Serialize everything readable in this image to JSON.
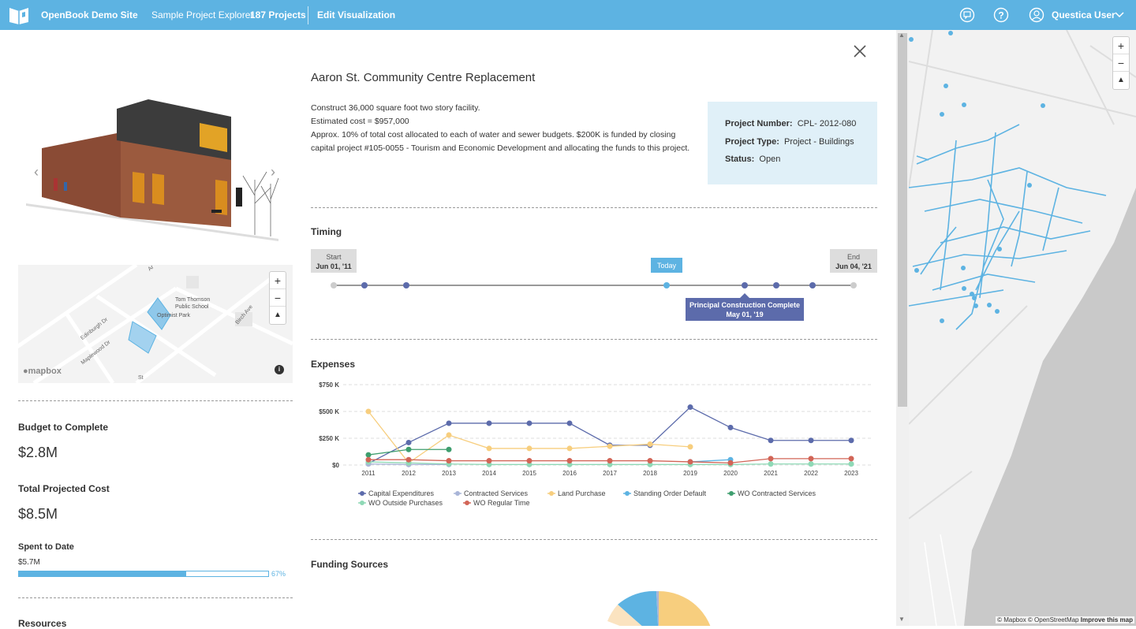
{
  "topbar": {
    "site_name": "OpenBook Demo Site",
    "explorer": "Sample Project Explorer",
    "project_count": "187 Projects",
    "edit_visualization": "Edit Visualization",
    "user_name": "Questica User",
    "bg_color": "#5db3e2"
  },
  "minimap": {
    "labels": [
      "Tom Thomson Public School",
      "Optimist Park",
      "Edinburgh Dr",
      "Maplewood Dr",
      "Birch Ave",
      "St",
      "Ar"
    ],
    "brand": "mapbox"
  },
  "metrics": {
    "budget_label": "Budget to Complete",
    "budget_value": "$2.8M",
    "total_label": "Total Projected Cost",
    "total_value": "$8.5M",
    "spent_label": "Spent to Date",
    "spent_value": "$5.7M",
    "spent_percent": 67,
    "spent_percent_text": "67%",
    "resources_label": "Resources"
  },
  "project": {
    "title": "Aaron St. Community Centre Replacement",
    "description": [
      "Construct 36,000 square foot two story facility.",
      "Estimated cost = $957,000",
      "Approx. 10% of total cost allocated to each of water and sewer budgets. $200K is funded by closing capital project #105-0055 - Tourism and Economic Development and allocating the funds to this project."
    ],
    "number_label": "Project Number:",
    "number_value": "CPL- 2012-080",
    "type_label": "Project Type:",
    "type_value": "Project - Buildings",
    "status_label": "Status:",
    "status_value": "Open"
  },
  "timing": {
    "title": "Timing",
    "start_label": "Start",
    "start_date": "Jun 01, '11",
    "end_label": "End",
    "end_date": "Jun 04, '21",
    "today_label": "Today",
    "milestone_name": "Principal Construction Complete",
    "milestone_date": "May 01, '19"
  },
  "expenses": {
    "title": "Expenses"
  },
  "funding": {
    "title": "Funding Sources"
  },
  "bigmap": {
    "attribution": "© Mapbox © OpenStreetMap",
    "improve": "Improve this map"
  },
  "chart_data": {
    "type": "line",
    "title": "Expenses",
    "x": [
      "2011",
      "2012",
      "2013",
      "2014",
      "2015",
      "2016",
      "2017",
      "2018",
      "2019",
      "2020",
      "2021",
      "2022",
      "2023"
    ],
    "yticks": [
      "$0",
      "$250 K",
      "$500 K",
      "$750 K"
    ],
    "ylim": [
      0,
      750000
    ],
    "grid": true,
    "legend_position": "bottom",
    "series": [
      {
        "name": "Capital Expenditures",
        "color": "#5c6bab",
        "values": [
          15000,
          210000,
          390000,
          390000,
          390000,
          390000,
          185000,
          185000,
          540000,
          350000,
          230000,
          230000,
          230000
        ]
      },
      {
        "name": "Contracted Services",
        "color": "#a9b5d8",
        "values": [
          10000,
          5000,
          5000,
          null,
          null,
          null,
          null,
          null,
          null,
          null,
          null,
          null,
          null
        ]
      },
      {
        "name": "Land Purchase",
        "color": "#f7ce7e",
        "values": [
          500000,
          20000,
          280000,
          155000,
          155000,
          155000,
          175000,
          195000,
          170000,
          null,
          null,
          null,
          null
        ]
      },
      {
        "name": "Standing Order Default",
        "color": "#5db3e2",
        "values": [
          null,
          null,
          null,
          null,
          null,
          null,
          null,
          null,
          30000,
          50000,
          null,
          null,
          null
        ]
      },
      {
        "name": "WO Contracted Services",
        "color": "#3e9e6e",
        "values": [
          95000,
          145000,
          145000,
          null,
          null,
          null,
          null,
          null,
          null,
          null,
          null,
          null,
          null
        ]
      },
      {
        "name": "WO Outside Purchases",
        "color": "#8fd9b6",
        "values": [
          30000,
          20000,
          10000,
          5000,
          5000,
          5000,
          5000,
          5000,
          5000,
          5000,
          10000,
          10000,
          10000
        ]
      },
      {
        "name": "WO Regular Time",
        "color": "#d26557",
        "values": [
          50000,
          50000,
          40000,
          40000,
          40000,
          40000,
          40000,
          40000,
          30000,
          20000,
          60000,
          60000,
          60000
        ]
      }
    ]
  }
}
